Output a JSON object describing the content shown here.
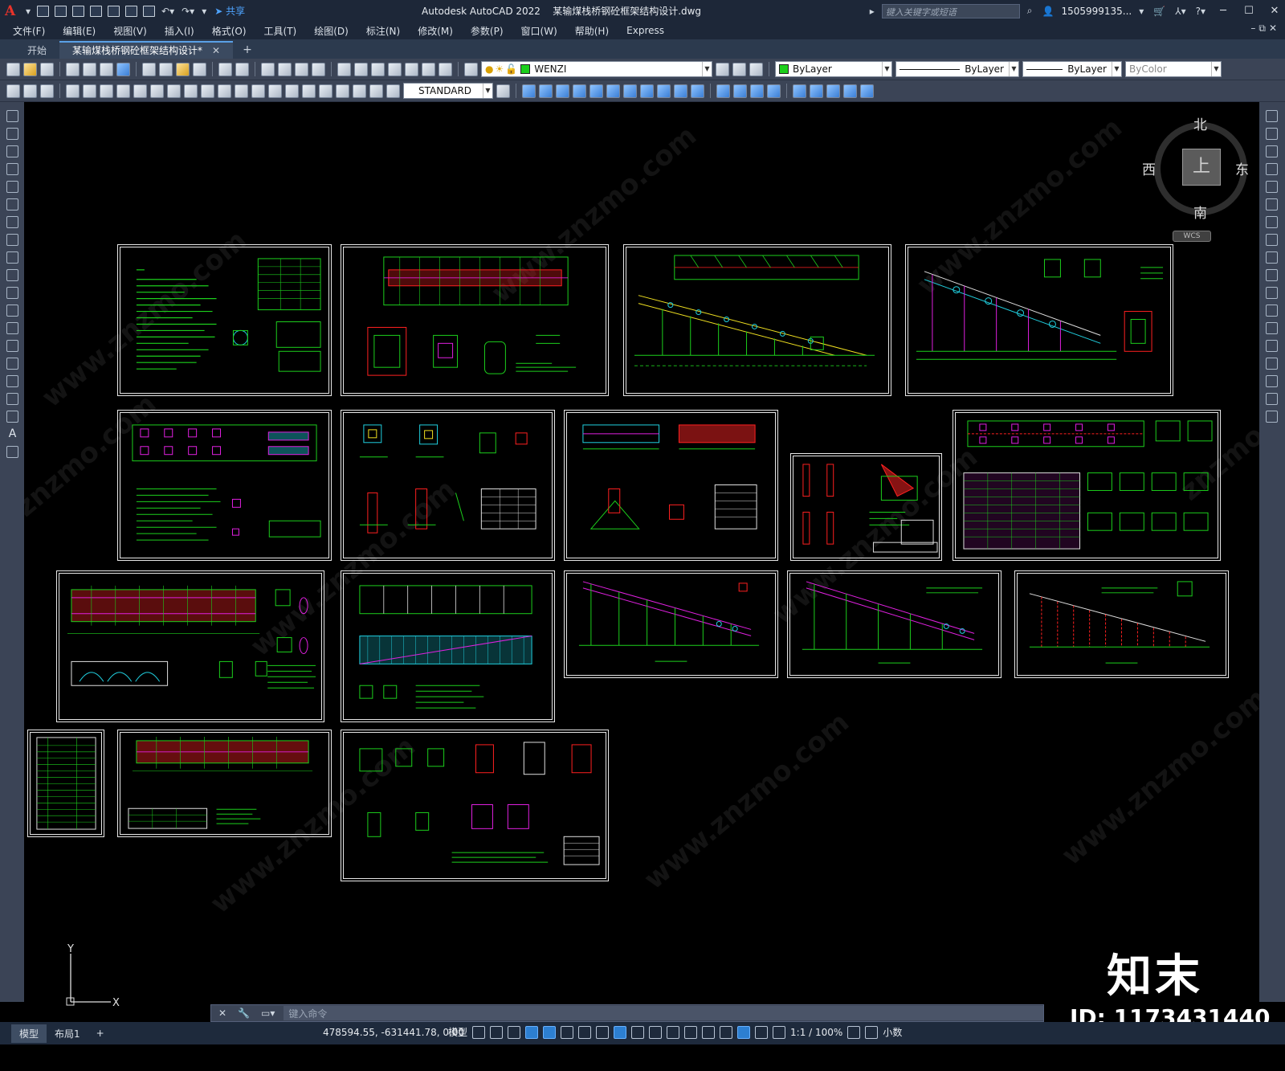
{
  "app": {
    "title": "Autodesk AutoCAD 2022",
    "file": "某输煤栈桥钢砼框架结构设计.dwg",
    "share": "共享",
    "search_placeholder": "键入关键字或短语",
    "user": "1505999135...",
    "logo_letter": "A"
  },
  "menu": [
    "文件(F)",
    "编辑(E)",
    "视图(V)",
    "插入(I)",
    "格式(O)",
    "工具(T)",
    "绘图(D)",
    "标注(N)",
    "修改(M)",
    "参数(P)",
    "窗口(W)",
    "帮助(H)",
    "Express"
  ],
  "tabs": {
    "start": "开始",
    "active": "某输煤栈桥钢砼框架结构设计*",
    "add": "+"
  },
  "toolbar": {
    "layer": "WENZI",
    "color": "ByLayer",
    "linetype": "ByLayer",
    "lineweight": "ByLayer",
    "plotstyle": "ByColor",
    "textstyle": "STANDARD"
  },
  "viewcube": {
    "north": "北",
    "south": "南",
    "east": "东",
    "west": "西",
    "top": "上",
    "wcs": "WCS"
  },
  "ucs": {
    "x": "X",
    "y": "Y"
  },
  "command": {
    "placeholder": "键入命令"
  },
  "status": {
    "model_tab": "模型",
    "layout_tab": "布局1",
    "add": "+",
    "coords": "478594.55, -631441.78, 0.00",
    "model_mode": "模型",
    "scale": "1:1 / 100%",
    "units": "小数"
  },
  "watermark": {
    "brand": "知末",
    "id": "ID: 1173431440",
    "url": "www.znzmo.com",
    "site": "znzmo.com"
  },
  "colors": {
    "accent": "#5aa0e6",
    "drawing_green": "#1ccf1c",
    "drawing_magenta": "#e020e0",
    "drawing_red": "#ff2020",
    "drawing_cyan": "#20d0e0"
  }
}
